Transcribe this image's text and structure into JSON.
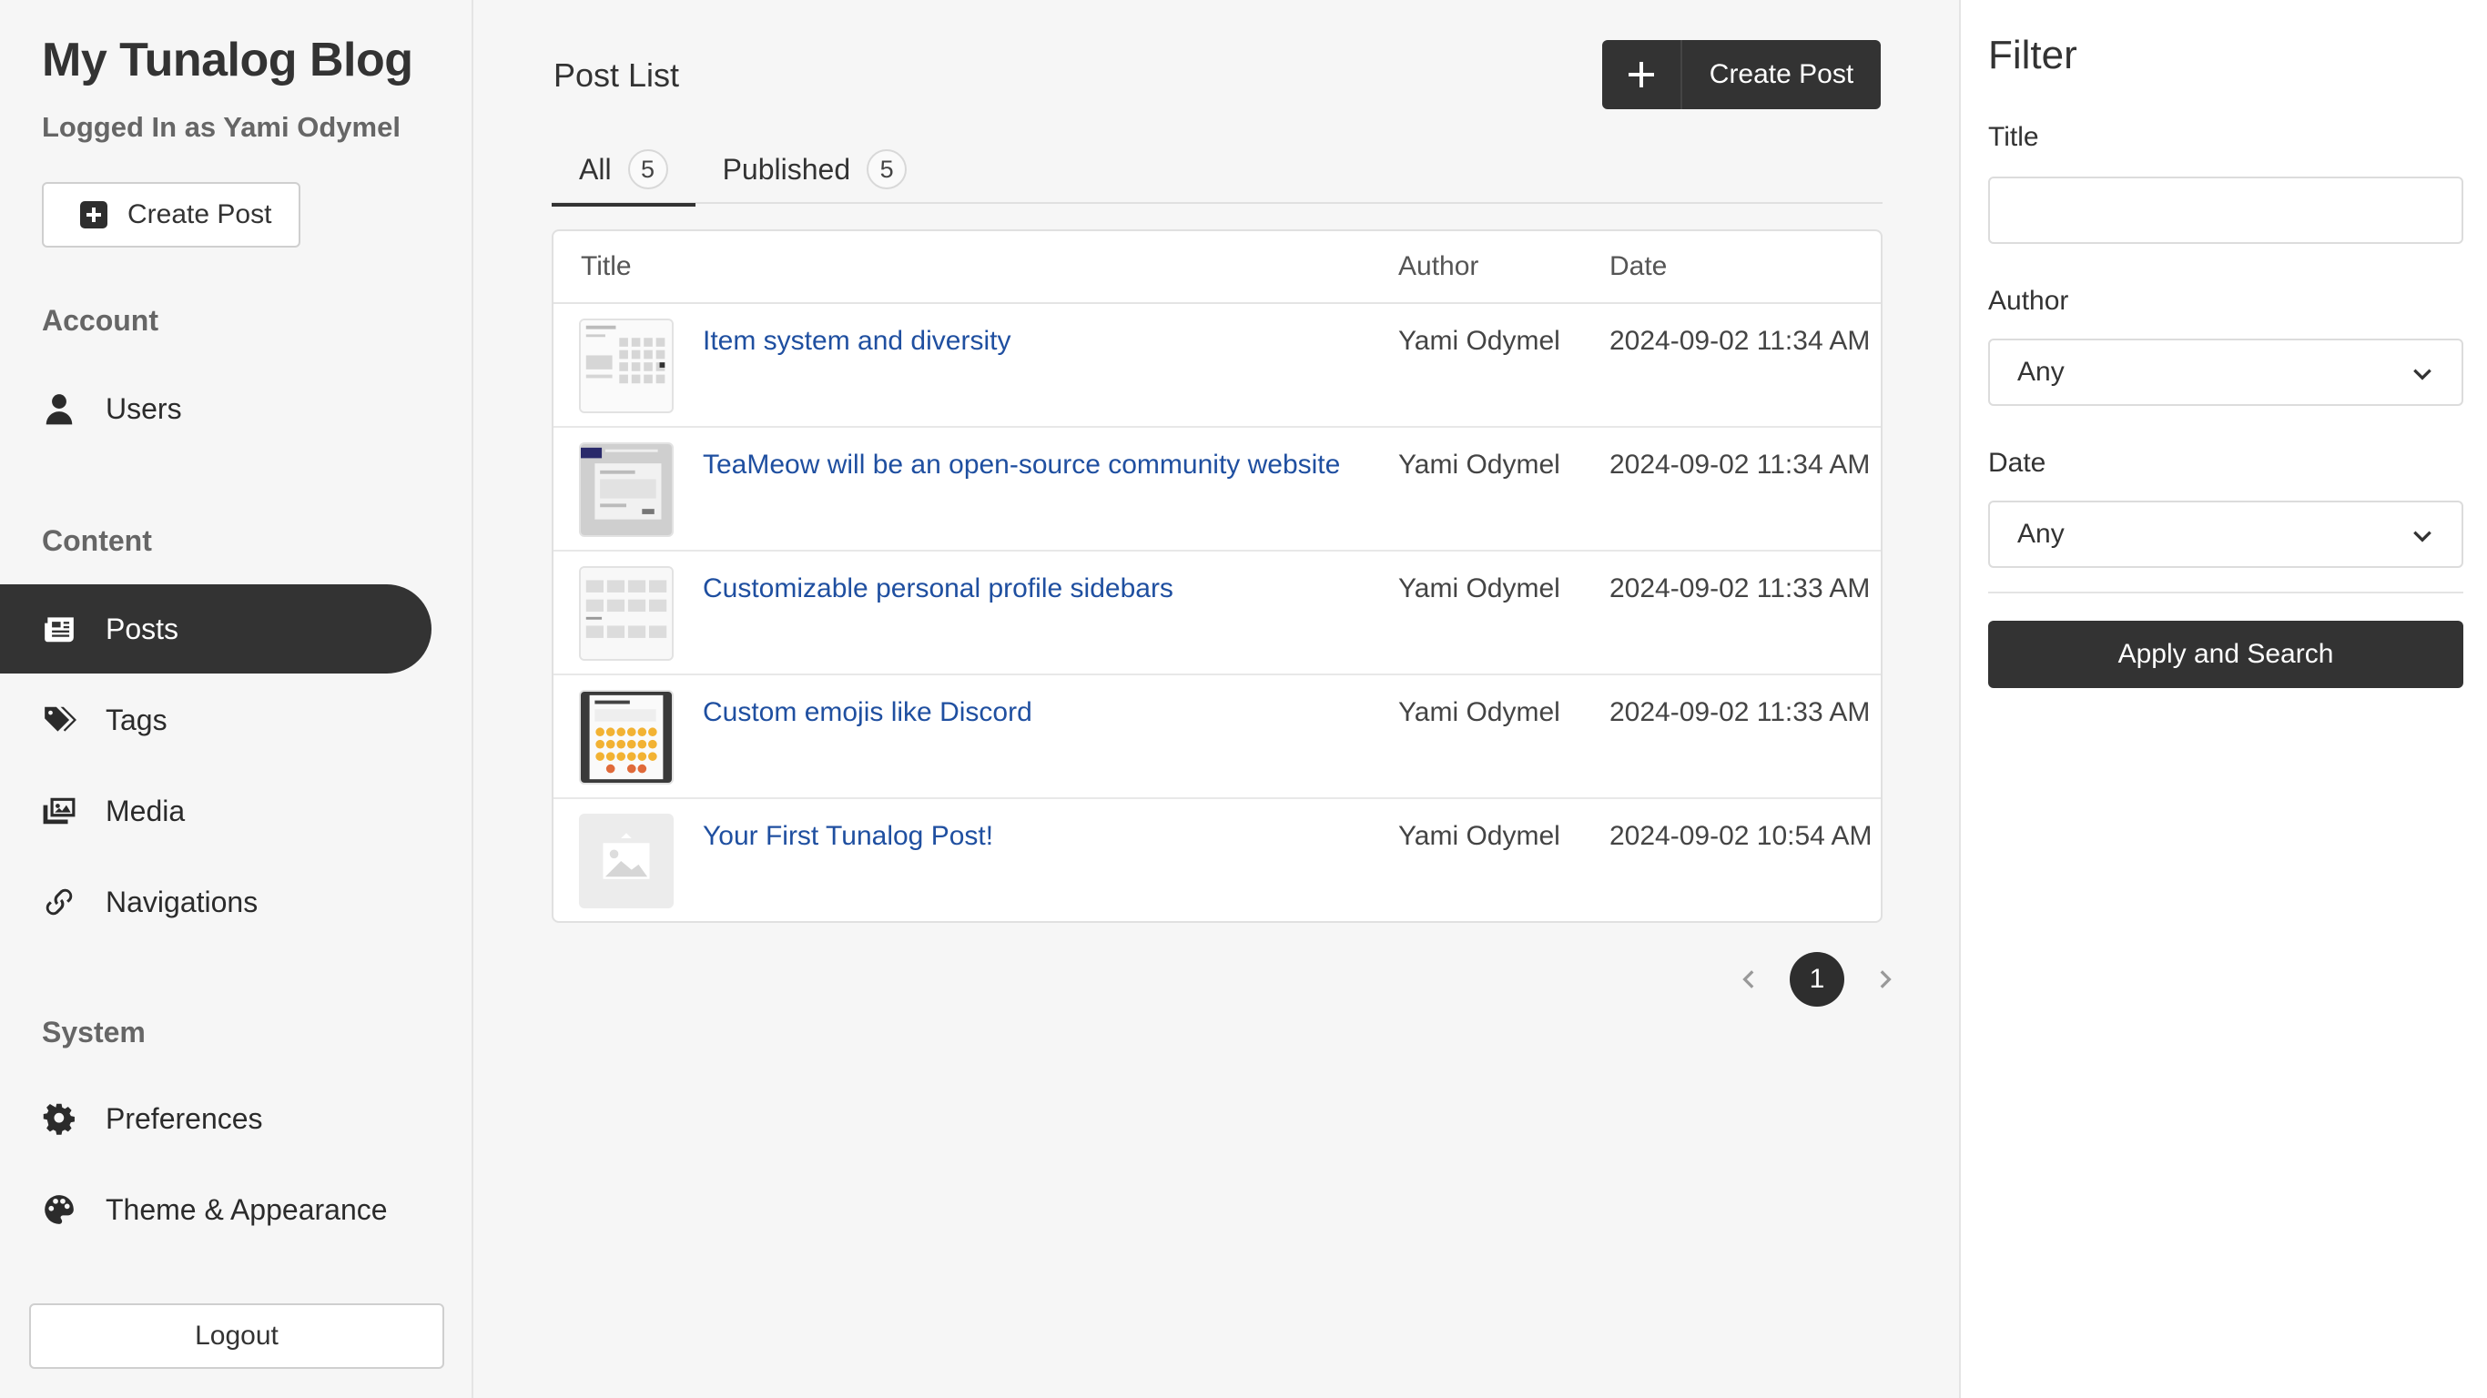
{
  "sidebar": {
    "brand": "My Tunalog Blog",
    "logged_in": "Logged In as Yami Odymel",
    "create_label": "Create Post",
    "sections": {
      "account": "Account",
      "content": "Content",
      "system": "System"
    },
    "items": [
      {
        "label": "Users",
        "icon": "user-icon"
      },
      {
        "label": "Posts",
        "icon": "newspaper-icon"
      },
      {
        "label": "Tags",
        "icon": "tags-icon"
      },
      {
        "label": "Media",
        "icon": "images-icon"
      },
      {
        "label": "Navigations",
        "icon": "link-icon"
      },
      {
        "label": "Preferences",
        "icon": "gear-icon"
      },
      {
        "label": "Theme & Appearance",
        "icon": "palette-icon"
      }
    ],
    "active_item": "Posts",
    "logout_label": "Logout"
  },
  "main": {
    "title": "Post List",
    "create_label": "Create Post",
    "tabs": [
      {
        "label": "All",
        "count": "5"
      },
      {
        "label": "Published",
        "count": "5"
      }
    ],
    "active_tab": "All",
    "table": {
      "headers": {
        "title": "Title",
        "author": "Author",
        "date": "Date"
      },
      "rows": [
        {
          "title": "Item system and diversity",
          "author": "Yami Odymel",
          "date": "2024-09-02 11:34 AM",
          "thumb": "screenshot-grid"
        },
        {
          "title": "TeaMeow will be an open-source community website",
          "author": "Yami Odymel",
          "date": "2024-09-02 11:34 AM",
          "thumb": "screenshot-dark"
        },
        {
          "title": "Customizable personal profile sidebars",
          "author": "Yami Odymel",
          "date": "2024-09-02 11:33 AM",
          "thumb": "screenshot-grid"
        },
        {
          "title": "Custom emojis like Discord",
          "author": "Yami Odymel",
          "date": "2024-09-02 11:33 AM",
          "thumb": "screenshot-emoji"
        },
        {
          "title": "Your First Tunalog Post!",
          "author": "Yami Odymel",
          "date": "2024-09-02 10:54 AM",
          "thumb": "image-placeholder"
        }
      ]
    },
    "pager": {
      "current": "1"
    }
  },
  "filter": {
    "heading": "Filter",
    "title_label": "Title",
    "title_value": "",
    "author_label": "Author",
    "author_value": "Any",
    "date_label": "Date",
    "date_value": "Any",
    "apply_label": "Apply and Search"
  },
  "colors": {
    "accent": "#333333",
    "link": "#1f4fa0",
    "background": "#f6f6f6"
  }
}
